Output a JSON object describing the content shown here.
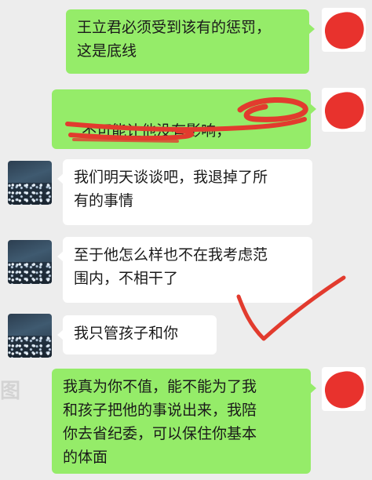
{
  "messages": [
    {
      "sender": "me",
      "text": "王立君必须受到该有的惩罚，\n这是底线"
    },
    {
      "sender": "me",
      "text": "不可能让他没有影响，"
    },
    {
      "sender": "other",
      "text": "我们明天谈谈吧，我退掉了所\n有的事情"
    },
    {
      "sender": "other",
      "text": "至于他怎么样也不在我考虑范\n围内，不相干了"
    },
    {
      "sender": "other",
      "text": "我只管孩子和你"
    },
    {
      "sender": "me",
      "text": "我真为你不值，能不能为了我\n和孩子把他的事说出来，我陪\n你去省纪委，可以保住你基本\n的体面"
    }
  ],
  "colors": {
    "me_bubble": "#95ec69",
    "other_bubble": "#ffffff",
    "background": "#ededed",
    "redaction": "#e8322d",
    "annotation": "#e23b2e"
  },
  "icons": {
    "my_avatar": "red-redacted-avatar",
    "other_avatar": "night-scenery-avatar",
    "annotation": "red-checkmark"
  }
}
